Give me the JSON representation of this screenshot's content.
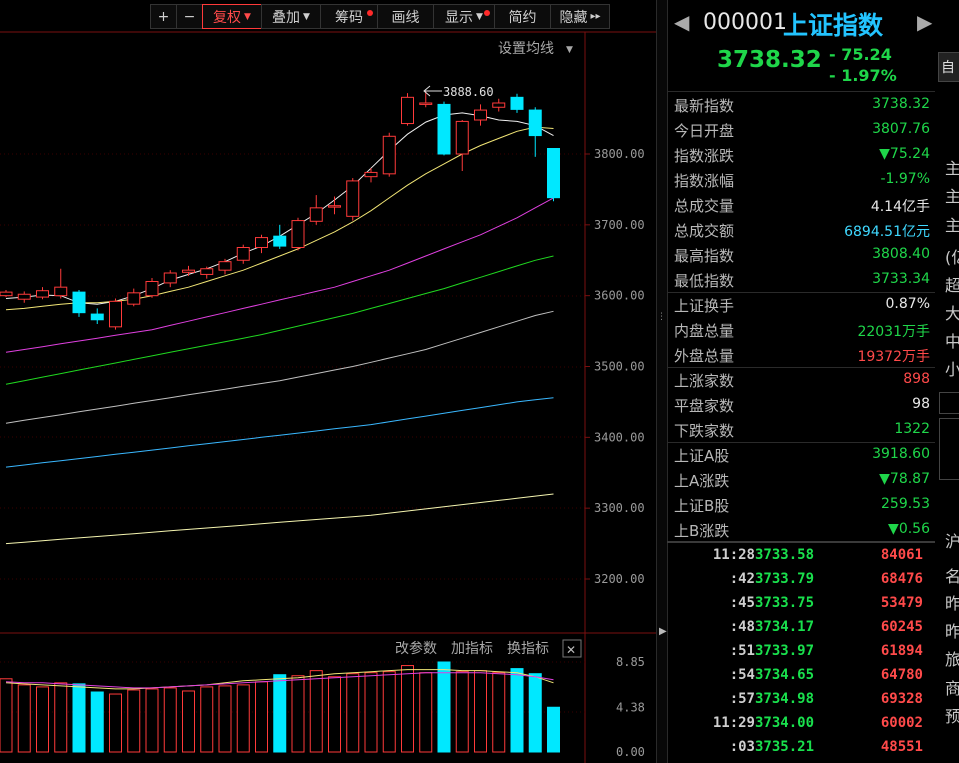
{
  "toolbar": {
    "items": [
      {
        "label": "+",
        "w": 0
      },
      {
        "label": "−"
      },
      {
        "label": "复权"
      },
      {
        "label": "叠加"
      },
      {
        "label": "筹码"
      },
      {
        "label": "画线"
      },
      {
        "label": "显示"
      },
      {
        "label": "简约"
      },
      {
        "label": "隐藏"
      }
    ],
    "plus": "+",
    "minus": "−",
    "fuquan": "复权",
    "diejia": "叠加",
    "chouma": "筹码",
    "huaxian": "画线",
    "xianshi": "显示",
    "jianyue": "简约",
    "yincang": "隐藏",
    "expand": "▸▸"
  },
  "chart": {
    "ma_setting": "设置均线",
    "high_marker": "3888.60",
    "price_ticks": [
      "3800.00",
      "3700.00",
      "3600.00",
      "3500.00",
      "3400.00",
      "3300.00",
      "3200.00"
    ],
    "indicator_buttons": {
      "change_params": "改参数",
      "add_indicator": "加指标",
      "switch_indicator": "换指标",
      "close": "✕"
    },
    "volume_ticks": [
      "8.85",
      "4.38",
      "0.00"
    ]
  },
  "colors": {
    "up": "#ff3a3a",
    "down": "#00e8ff",
    "ma5": "#f0f0f0",
    "ma10": "#f2e676",
    "ma20": "#e040e0",
    "ma30": "#20d820",
    "ma60": "#c0c0c0",
    "ma120": "#3ab8ff",
    "ma250": "#f5f5b0"
  },
  "chart_data": {
    "type": "candlestick",
    "note_price_axis": [
      3200,
      3800
    ],
    "candles": [
      {
        "o": 3600,
        "c": 3605,
        "h": 3608,
        "l": 3598
      },
      {
        "o": 3595,
        "c": 3602,
        "h": 3606,
        "l": 3590
      },
      {
        "o": 3598,
        "c": 3607,
        "h": 3612,
        "l": 3595
      },
      {
        "o": 3600,
        "c": 3612,
        "h": 3638,
        "l": 3596
      },
      {
        "o": 3605,
        "c": 3576,
        "h": 3608,
        "l": 3570
      },
      {
        "o": 3574,
        "c": 3566,
        "h": 3582,
        "l": 3560
      },
      {
        "o": 3556,
        "c": 3592,
        "h": 3596,
        "l": 3552
      },
      {
        "o": 3588,
        "c": 3604,
        "h": 3610,
        "l": 3585
      },
      {
        "o": 3600,
        "c": 3620,
        "h": 3625,
        "l": 3597
      },
      {
        "o": 3618,
        "c": 3632,
        "h": 3636,
        "l": 3612
      },
      {
        "o": 3633,
        "c": 3636,
        "h": 3642,
        "l": 3628
      },
      {
        "o": 3630,
        "c": 3638,
        "h": 3641,
        "l": 3624
      },
      {
        "o": 3636,
        "c": 3648,
        "h": 3652,
        "l": 3630
      },
      {
        "o": 3650,
        "c": 3668,
        "h": 3672,
        "l": 3645
      },
      {
        "o": 3668,
        "c": 3682,
        "h": 3686,
        "l": 3660
      },
      {
        "o": 3684,
        "c": 3670,
        "h": 3700,
        "l": 3666
      },
      {
        "o": 3668,
        "c": 3706,
        "h": 3710,
        "l": 3664
      },
      {
        "o": 3705,
        "c": 3724,
        "h": 3742,
        "l": 3700
      },
      {
        "o": 3725,
        "c": 3727,
        "h": 3740,
        "l": 3715
      },
      {
        "o": 3712,
        "c": 3762,
        "h": 3766,
        "l": 3706
      },
      {
        "o": 3768,
        "c": 3774,
        "h": 3780,
        "l": 3760
      },
      {
        "o": 3772,
        "c": 3825,
        "h": 3830,
        "l": 3768
      },
      {
        "o": 3843,
        "c": 3880,
        "h": 3886,
        "l": 3840
      },
      {
        "o": 3870,
        "c": 3872,
        "h": 3888.6,
        "l": 3866
      },
      {
        "o": 3870,
        "c": 3800,
        "h": 3874,
        "l": 3798
      },
      {
        "o": 3800,
        "c": 3846,
        "h": 3848,
        "l": 3776
      },
      {
        "o": 3848,
        "c": 3862,
        "h": 3870,
        "l": 3840
      },
      {
        "o": 3866,
        "c": 3872,
        "h": 3878,
        "l": 3860
      },
      {
        "o": 3880,
        "c": 3863,
        "h": 3885,
        "l": 3858
      },
      {
        "o": 3862,
        "c": 3826,
        "h": 3866,
        "l": 3796
      },
      {
        "o": 3807.76,
        "c": 3738.32,
        "h": 3808.4,
        "l": 3733.34
      }
    ],
    "ma": {
      "ma5": [
        3596,
        3598,
        3601,
        3600,
        3590,
        3588,
        3592,
        3600,
        3610,
        3622,
        3630,
        3638,
        3648,
        3660,
        3670,
        3684,
        3700,
        3716,
        3735,
        3755,
        3780,
        3805,
        3828,
        3845,
        3855,
        3858,
        3854,
        3848,
        3846,
        3840,
        3826
      ],
      "ma10": [
        3580,
        3582,
        3585,
        3588,
        3590,
        3590,
        3592,
        3595,
        3600,
        3606,
        3612,
        3620,
        3628,
        3636,
        3646,
        3656,
        3666,
        3678,
        3690,
        3704,
        3720,
        3738,
        3756,
        3772,
        3786,
        3800,
        3812,
        3822,
        3832,
        3838,
        3836
      ],
      "ma20": [
        3520,
        3524,
        3528,
        3532,
        3536,
        3540,
        3544,
        3548,
        3552,
        3558,
        3564,
        3570,
        3576,
        3582,
        3588,
        3594,
        3600,
        3606,
        3612,
        3620,
        3628,
        3636,
        3646,
        3656,
        3666,
        3676,
        3686,
        3698,
        3710,
        3724,
        3738
      ],
      "ma30": [
        3475,
        3480,
        3485,
        3490,
        3495,
        3500,
        3505,
        3510,
        3515,
        3520,
        3525,
        3530,
        3535,
        3540,
        3545,
        3551,
        3557,
        3563,
        3569,
        3575,
        3582,
        3589,
        3596,
        3603,
        3610,
        3618,
        3626,
        3634,
        3642,
        3650,
        3656
      ],
      "ma60": [
        3420,
        3424,
        3428,
        3432,
        3436,
        3440,
        3444,
        3448,
        3452,
        3456,
        3460,
        3464,
        3468,
        3472,
        3476,
        3480,
        3485,
        3490,
        3495,
        3500,
        3506,
        3512,
        3518,
        3524,
        3532,
        3540,
        3548,
        3556,
        3564,
        3572,
        3578
      ],
      "ma120": [
        3358,
        3361,
        3364,
        3367,
        3370,
        3373,
        3376,
        3379,
        3382,
        3385,
        3388,
        3391,
        3394,
        3397,
        3400,
        3403,
        3406,
        3409,
        3412,
        3415,
        3418,
        3422,
        3426,
        3430,
        3434,
        3438,
        3442,
        3446,
        3450,
        3453,
        3456
      ],
      "ma250": [
        3250,
        3252,
        3254,
        3256,
        3258,
        3260,
        3262,
        3264,
        3266,
        3268,
        3270,
        3272,
        3274,
        3276,
        3278,
        3280,
        3282,
        3284,
        3286,
        3288,
        3290,
        3293,
        3296,
        3299,
        3302,
        3305,
        3308,
        3311,
        3314,
        3317,
        3320
      ]
    },
    "volume_axis": [
      0,
      8.85
    ],
    "volume": [
      7.2,
      6.6,
      6.4,
      6.8,
      6.7,
      5.9,
      5.7,
      6.1,
      6.2,
      6.3,
      6.0,
      6.4,
      6.5,
      6.6,
      6.9,
      7.6,
      7.5,
      8.0,
      7.4,
      7.7,
      7.8,
      7.9,
      8.5,
      7.8,
      8.85,
      7.9,
      8.0,
      7.8,
      8.2,
      7.7,
      4.4
    ],
    "vol_ma1": [
      6.8,
      6.7,
      6.6,
      6.5,
      6.4,
      6.3,
      6.2,
      6.2,
      6.3,
      6.4,
      6.5,
      6.6,
      6.8,
      7.0,
      7.1,
      7.2,
      7.3,
      7.5,
      7.7,
      7.8,
      7.9,
      8.0,
      8.1,
      8.1,
      8.1,
      8.0,
      8.0,
      7.9,
      7.8,
      7.4,
      6.8
    ],
    "vol_ma2": [
      6.9,
      6.8,
      6.8,
      6.7,
      6.6,
      6.5,
      6.4,
      6.3,
      6.3,
      6.4,
      6.5,
      6.6,
      6.7,
      6.8,
      6.9,
      7.0,
      7.1,
      7.2,
      7.3,
      7.4,
      7.5,
      7.6,
      7.7,
      7.8,
      7.8,
      7.8,
      7.8,
      7.7,
      7.6,
      7.4,
      7.1
    ]
  },
  "panel": {
    "code": "000001",
    "name": "上证指数",
    "price": "3738.32",
    "change": "- 75.24",
    "pct": "- 1.97%",
    "rows": [
      {
        "label": "最新指数",
        "value": "3738.32",
        "color": "green"
      },
      {
        "label": "今日开盘",
        "value": "3807.76",
        "color": "green"
      },
      {
        "label": "指数涨跌",
        "value": "▼75.24",
        "color": "green"
      },
      {
        "label": "指数涨幅",
        "value": "-1.97%",
        "color": "green"
      },
      {
        "label": "总成交量",
        "value": "4.14亿手",
        "color": "white"
      },
      {
        "label": "总成交额",
        "value": "6894.51亿元",
        "color": "cyan"
      },
      {
        "label": "最高指数",
        "value": "3808.40",
        "color": "green"
      },
      {
        "label": "最低指数",
        "value": "3733.34",
        "color": "green"
      },
      {
        "label": "上证换手",
        "value": "0.87%",
        "color": "white"
      },
      {
        "label": "内盘总量",
        "value": "22031万手",
        "color": "green"
      },
      {
        "label": "外盘总量",
        "value": "19372万手",
        "color": "red"
      },
      {
        "label": "上涨家数",
        "value": "898",
        "color": "red"
      },
      {
        "label": "平盘家数",
        "value": "98",
        "color": "white"
      },
      {
        "label": "下跌家数",
        "value": "1322",
        "color": "green"
      },
      {
        "label": "上证A股",
        "value": "3918.60",
        "color": "green"
      },
      {
        "label": "上A涨跌",
        "value": "▼78.87",
        "color": "green"
      },
      {
        "label": "上证B股",
        "value": "259.53",
        "color": "green"
      },
      {
        "label": "上B涨跌",
        "value": "▼0.56",
        "color": "green"
      }
    ],
    "ticks": [
      {
        "time": "11:28",
        "price": "3733.58",
        "vol": "84061"
      },
      {
        "time": ":42",
        "price": "3733.79",
        "vol": "68476"
      },
      {
        "time": ":45",
        "price": "3733.75",
        "vol": "53479"
      },
      {
        "time": ":48",
        "price": "3734.17",
        "vol": "60245"
      },
      {
        "time": ":51",
        "price": "3733.97",
        "vol": "61894"
      },
      {
        "time": ":54",
        "price": "3734.65",
        "vol": "64780"
      },
      {
        "time": ":57",
        "price": "3734.98",
        "vol": "69328"
      },
      {
        "time": "11:29",
        "price": "3734.00",
        "vol": "60002"
      },
      {
        "time": ":03",
        "price": "3735.21",
        "vol": "48551"
      }
    ]
  },
  "edge_panel": {
    "tab": "自",
    "glyphs": [
      "主",
      "主",
      "主",
      "(亿",
      "超",
      "大",
      "中",
      "小",
      "沪",
      "名",
      "昨",
      "昨",
      "旅",
      "商",
      "预"
    ]
  }
}
